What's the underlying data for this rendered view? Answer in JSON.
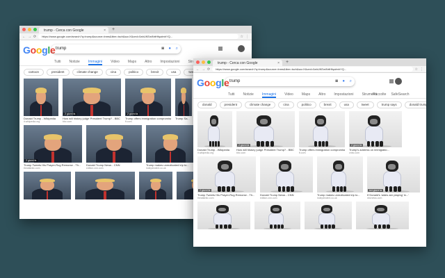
{
  "windows": [
    {
      "tab_title": "trump - Cerca con Google",
      "url": "https://www.google.com/search?q=trump&source=lnms&tbm=isch&sa=X&ved=0ahUKEwiNrtHfqalmhYQ...",
      "query": "trump",
      "tabs": [
        "Tutti",
        "Notizie",
        "Immagini",
        "Video",
        "Maps",
        "Altro",
        "Impostazioni",
        "Strumenti"
      ],
      "active_tab": "Immagini",
      "chips": [
        "cartoon",
        "president",
        "climate change",
        "cina",
        "politico",
        "brexit",
        "usa",
        "tweet",
        "trump says",
        "donald trump"
      ],
      "rows": [
        [
          {
            "caption": "Donald Trump - Wikipedia",
            "source": "it.wikipedia.org",
            "badge": ""
          },
          {
            "caption": "How will history judge President Trump? - BBC N...",
            "source": "bbc.com",
            "badge": "2 giorni fa"
          },
          {
            "caption": "Trump offers immigration compromise to...",
            "source": "ft.com",
            "badge": "2 giorni fa"
          },
          {
            "caption": "Trump Sa...",
            "source": "",
            "badge": ""
          }
        ],
        [
          {
            "caption": "Trump Tweets His Prayer-Rug Remorse - Th...",
            "source": "theatlantic.com",
            "badge": "2 giorni fa"
          },
          {
            "caption": "Donald Trump News - CNN",
            "source": "edition.cnn.com",
            "badge": ""
          },
          {
            "caption": "Trump makes unmotivated trip to...",
            "source": "independent.co.uk",
            "badge": ""
          }
        ],
        [
          {
            "caption": "",
            "source": "",
            "badge": ""
          },
          {
            "caption": "",
            "source": "",
            "badge": ""
          },
          {
            "caption": "",
            "source": "",
            "badge": ""
          },
          {
            "caption": "",
            "source": "",
            "badge": ""
          }
        ]
      ]
    },
    {
      "tab_title": "trump - Cerca con Google",
      "url": "https://www.google.com/search?q=trump&source=lnms&tbm=isch&sa=X&ved=0ahUKEwiNrtHfqalmhYQ...",
      "query": "trump",
      "tabs": [
        "Tutti",
        "Notizie",
        "Immagini",
        "Video",
        "Maps",
        "Altro",
        "Impostazioni",
        "Strumenti"
      ],
      "active_tab": "Immagini",
      "right_links": [
        "Raccolte",
        "SafeSearch"
      ],
      "chips": [
        "donald",
        "president",
        "climate change",
        "cina",
        "politico",
        "brexit",
        "usa",
        "tweet",
        "trump says",
        "donald trump"
      ],
      "rows": [
        [
          {
            "caption": "Donald Trump - Wikipedia",
            "source": "it.wikipedia.org",
            "badge": ""
          },
          {
            "caption": "How will history judge President Trump? - BBC N...",
            "source": "bbc.com",
            "badge": "2 giorni fa"
          },
          {
            "caption": "Trump offers immigration compromise to...",
            "source": "ft.com",
            "badge": ""
          },
          {
            "caption": "Trump's address on immigratio...",
            "source": "cnbc.com",
            "badge": "2 giorni fa"
          }
        ],
        [
          {
            "caption": "Trump Tweets His Prayer-Rug Remorse - Th...",
            "source": "theatlantic.com",
            "badge": "2 giorni fa"
          },
          {
            "caption": "Donald Trump News - CNN",
            "source": "edition.cnn.com",
            "badge": ""
          },
          {
            "caption": "Trump makes unmotivated trip to...",
            "source": "independent.co.uk",
            "badge": ""
          },
          {
            "caption": "If Donald's 'aides are playing' in...'",
            "source": "nbcnews.com",
            "badge": "ieri giorni fa"
          }
        ],
        [
          {
            "caption": "",
            "source": "",
            "badge": ""
          },
          {
            "caption": "",
            "source": "",
            "badge": ""
          },
          {
            "caption": "",
            "source": "",
            "badge": ""
          },
          {
            "caption": "",
            "source": "",
            "badge": ""
          }
        ]
      ]
    }
  ],
  "icons": {
    "mic": "microphone-icon",
    "camera": "camera-icon",
    "search": "search-icon",
    "apps": "apps-grid-icon"
  },
  "colors": {
    "background": "#2e4f58",
    "accent": "#1a73e8"
  }
}
